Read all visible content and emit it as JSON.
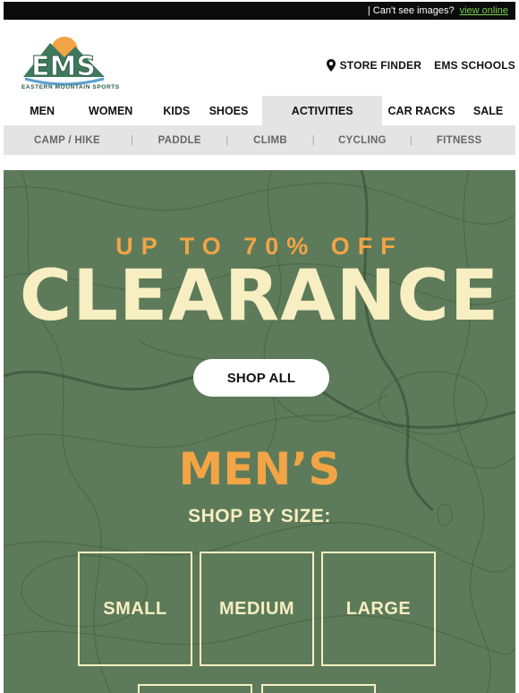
{
  "topbar": {
    "text": "| Can't see images?",
    "link": "view online"
  },
  "brand": {
    "logo_letters": "EMS",
    "tagline": "EASTERN MOUNTAIN SPORTS"
  },
  "header_links": {
    "store_finder": "STORE FINDER",
    "schools": "EMS SCHOOLS"
  },
  "main_nav": [
    "MEN",
    "WOMEN",
    "KIDS",
    "SHOES",
    "ACTIVITIES",
    "CAR RACKS",
    "SALE"
  ],
  "main_nav_active": "ACTIVITIES",
  "sub_nav": [
    "CAMP / HIKE",
    "PADDLE",
    "CLIMB",
    "CYCLING",
    "FITNESS"
  ],
  "hero": {
    "promo_small": "UP TO 70% OFF",
    "promo_big": "CLEARANCE",
    "cta": "SHOP ALL",
    "section_title": "MEN’S",
    "section_subtitle": "SHOP BY SIZE:",
    "sizes": [
      "SMALL",
      "MEDIUM",
      "LARGE"
    ]
  },
  "colors": {
    "hero_bg": "#5d7b5a",
    "accent_orange": "#f2a446",
    "cream": "#f7eec1",
    "link_green": "#7ad14a",
    "nav_active_bg": "#e4e4e4"
  }
}
